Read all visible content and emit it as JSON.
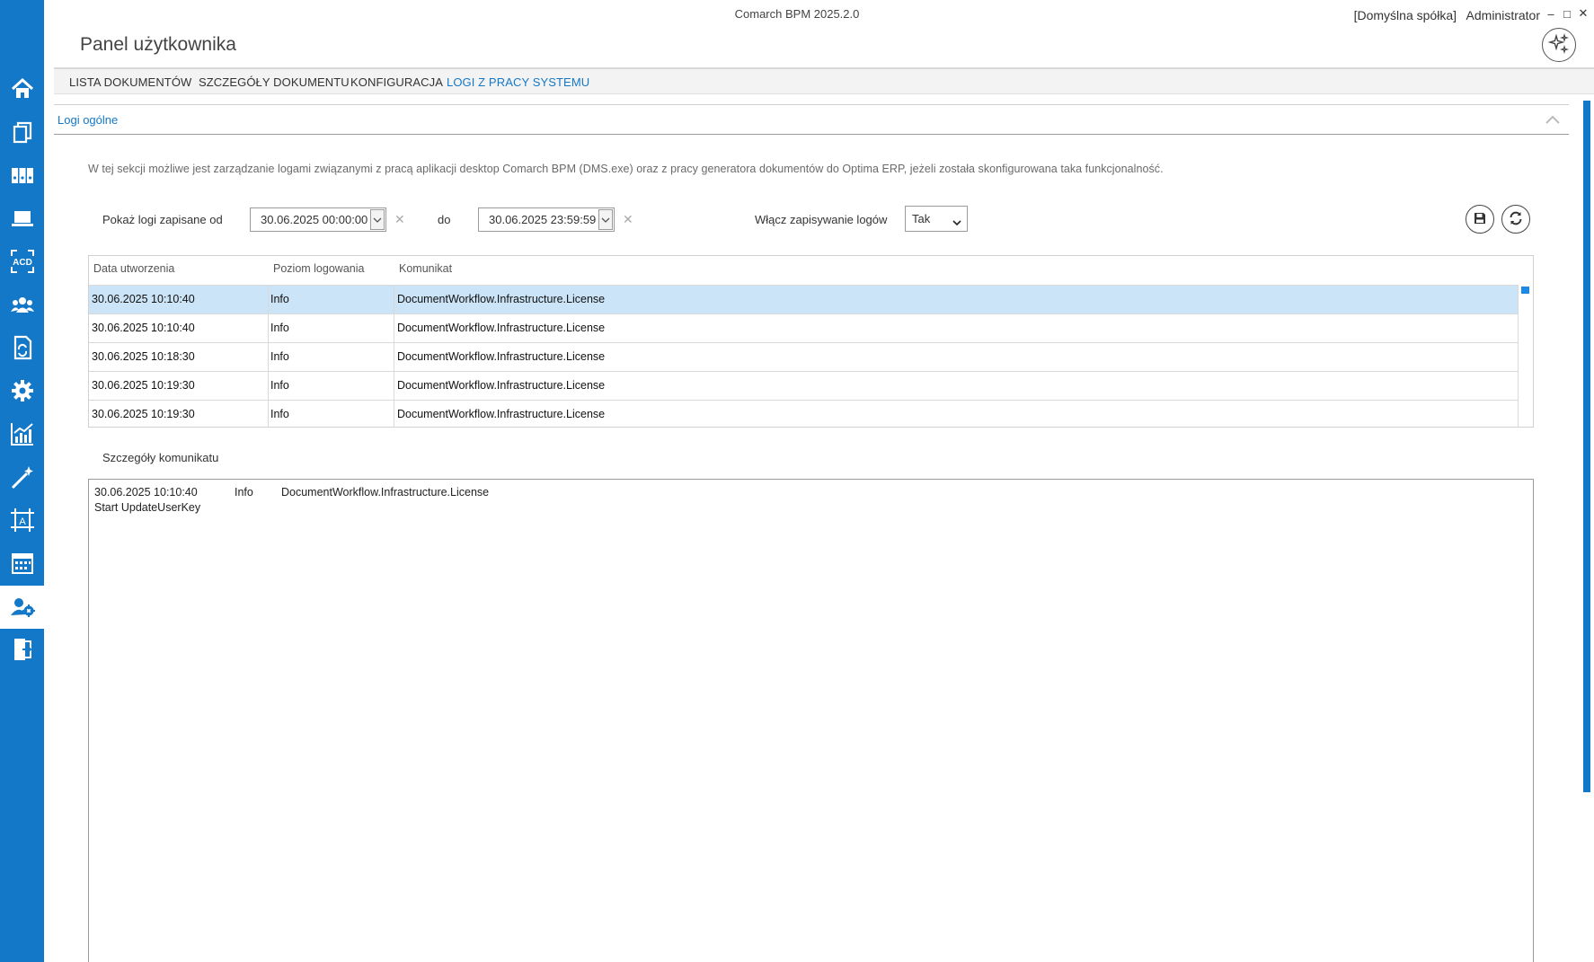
{
  "window": {
    "app_title": "Comarch BPM 2025.2.0",
    "company": "[Domyślna spółka]",
    "user": "Administrator"
  },
  "page_title": "Panel użytkownika",
  "sidebar": {
    "items": [
      {
        "icon": "home-icon"
      },
      {
        "icon": "documents-icon"
      },
      {
        "icon": "binders-icon"
      },
      {
        "icon": "laptop-icon"
      },
      {
        "icon": "acd-icon",
        "label": "ACD"
      },
      {
        "icon": "users-group-icon"
      },
      {
        "icon": "document-sync-icon"
      },
      {
        "icon": "gear-icon"
      },
      {
        "icon": "chart-icon"
      },
      {
        "icon": "magic-wand-icon"
      },
      {
        "icon": "text-frame-icon",
        "label": "A"
      },
      {
        "icon": "calendar-icon"
      },
      {
        "icon": "user-settings-icon",
        "active": true
      },
      {
        "icon": "exit-door-icon"
      }
    ]
  },
  "tabs": [
    {
      "label": "LISTA DOKUMENTÓW"
    },
    {
      "label": "SZCZEGÓŁY DOKUMENTU"
    },
    {
      "label": "KONFIGURACJA"
    },
    {
      "label": "LOGI Z PRACY SYSTEMU",
      "active": true
    }
  ],
  "section": {
    "title": "Logi ogólne",
    "description": "W tej sekcji możliwe jest zarządzanie logami związanymi z pracą aplikacji desktop Comarch BPM (DMS.exe) oraz z pracy generatora dokumentów do Optima ERP, jeżeli została skonfigurowana taka funkcjonalność."
  },
  "filters": {
    "from_label": "Pokaż logi zapisane od",
    "from_value": "30.06.2025 00:00:00",
    "to_label": "do",
    "to_value": "30.06.2025 23:59:59",
    "enable_label": "Włącz zapisywanie logów",
    "enable_value": "Tak",
    "clear_glyph": "✕"
  },
  "grid": {
    "columns": [
      "Data utworzenia",
      "Poziom logowania",
      "Komunikat"
    ],
    "rows": [
      {
        "date": "30.06.2025 10:10:40",
        "level": "Info",
        "message": "DocumentWorkflow.Infrastructure.License",
        "selected": true
      },
      {
        "date": "30.06.2025 10:10:40",
        "level": "Info",
        "message": "DocumentWorkflow.Infrastructure.License"
      },
      {
        "date": "30.06.2025 10:18:30",
        "level": "Info",
        "message": "DocumentWorkflow.Infrastructure.License"
      },
      {
        "date": "30.06.2025 10:19:30",
        "level": "Info",
        "message": "DocumentWorkflow.Infrastructure.License"
      },
      {
        "date": "30.06.2025 10:19:30",
        "level": "Info",
        "message": "DocumentWorkflow.Infrastructure.License"
      }
    ]
  },
  "details": {
    "label": "Szczegóły komunikatu",
    "date": "30.06.2025 10:10:40",
    "level": "Info",
    "source": "DocumentWorkflow.Infrastructure.License",
    "message": "Start UpdateUserKey"
  },
  "colors": {
    "accent": "#1478c8",
    "selected_row": "#cce4f7"
  }
}
